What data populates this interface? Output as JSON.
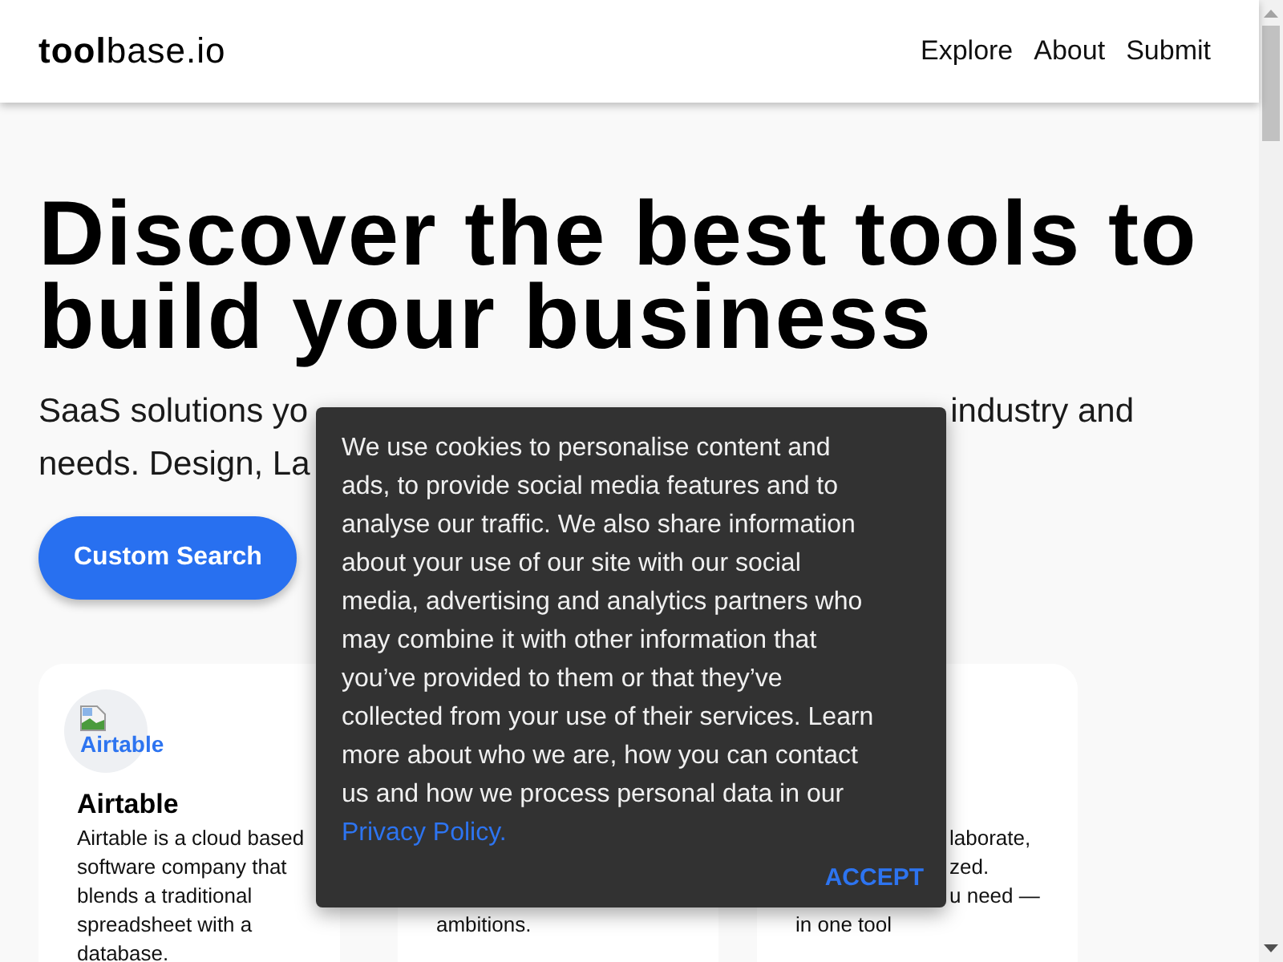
{
  "header": {
    "logo": "**tool**base.io",
    "nav": [
      "Explore",
      "About",
      "Submit"
    ]
  },
  "hero": {
    "title": "Discover the best tools to build your business",
    "subtitle_lines": [
      [
        "SaaS solutions yo",
        "industry and"
      ],
      [
        "needs. Design, La"
      ]
    ],
    "button": "Custom Search"
  },
  "cards": [
    {
      "logo_alt": "Airtable",
      "title": "Airtable",
      "description": "Airtable is a cloud based software company that blends a traditional spreadsheet with a database."
    },
    {
      "description_tail": "ambitions."
    },
    {
      "description_fragments": [
        "laborate,",
        "zed.",
        "u need —"
      ],
      "description_tail": "in one tool"
    }
  ],
  "cookie_banner": {
    "message": "We use cookies to personalise content and ads, to provide social media features and to analyse our traffic. We also share information about your use of our site with our social media, advertising and analytics partners who may combine it with other information that you’ve provided to them or that they’ve collected from your use of their services. Learn more about who we are, how you can contact us and how we process personal data in our",
    "link": "Privacy Policy.",
    "button": "ACCEPT"
  }
}
